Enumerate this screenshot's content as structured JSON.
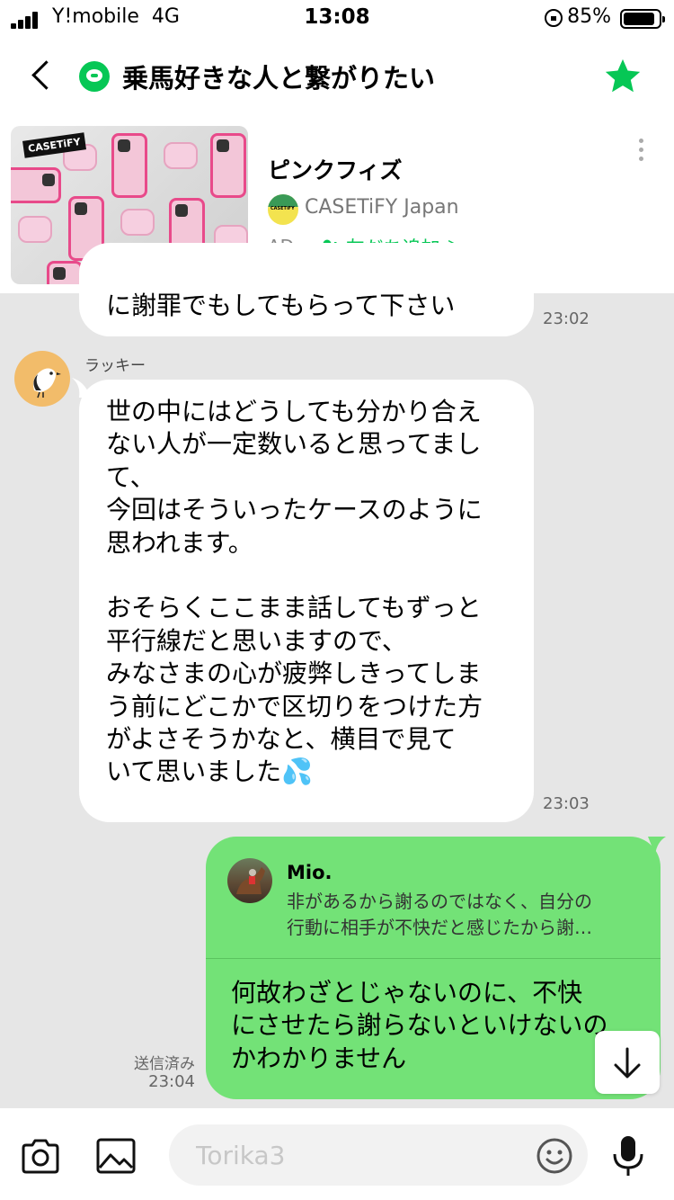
{
  "status_bar": {
    "carrier": "Y!mobile",
    "network": "4G",
    "time": "13:08",
    "battery": "85%"
  },
  "header": {
    "title": "乗馬好きな人と繋がりたい"
  },
  "ad": {
    "image_brand": "CASETiFY",
    "product_name": "ピンクフィズ",
    "sponsor": "CASETiFY Japan",
    "tag": "AD",
    "add_friend_label": "友だち追加 ＞"
  },
  "chat": {
    "prev_message": {
      "text_partial": "に謝罪でもしてもらって下さい",
      "time": "23:02"
    },
    "incoming": {
      "sender": "ラッキー",
      "text": "世の中にはどうしても分かり合え\nない人が一定数いると思ってまし\nて、\n今回はそういったケースのように\n思われます。\n\nおそらくここまま話してもずっと\n平行線だと思いますので、\nみなさまの心が疲弊しきってしま\nう前にどこかで区切りをつけた方\nがよさそうかなと、横目で見て\nいて思いました💦",
      "time": "23:03"
    },
    "outgoing": {
      "reply_to_name": "Mio.",
      "reply_to_text": "非があるから謝るのではなく、自分の\n行動に相手が不快だと感じたから謝…",
      "text": "何故わざとじゃないのに、不快\nにさせたら謝らないといけないの\nかわかりません",
      "read_label": "送信済み",
      "time": "23:04"
    }
  },
  "input": {
    "placeholder": "Torika3"
  },
  "colors": {
    "line_green": "#06c755",
    "sent_bubble": "#73e277",
    "chat_bg": "#e6e6e6"
  }
}
